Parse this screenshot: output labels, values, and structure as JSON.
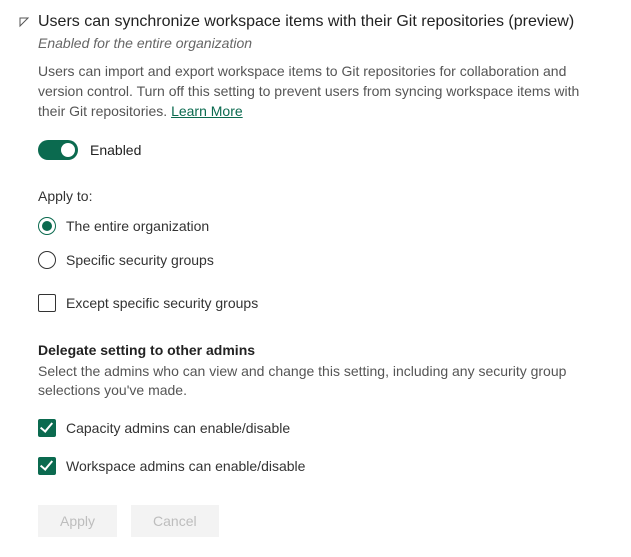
{
  "header": {
    "title": "Users can synchronize workspace items with their Git repositories (preview)",
    "subtitle": "Enabled for the entire organization"
  },
  "description": "Users can import and export workspace items to Git repositories for collaboration and version control. Turn off this setting to prevent users from syncing workspace items with their Git repositories. ",
  "learn_more": "Learn More",
  "toggle": {
    "state_label": "Enabled"
  },
  "apply_to": {
    "label": "Apply to:",
    "options": {
      "entire_org": "The entire organization",
      "specific_groups": "Specific security groups"
    },
    "except_label": "Except specific security groups"
  },
  "delegate": {
    "title": "Delegate setting to other admins",
    "description": "Select the admins who can view and change this setting, including any security group selections you've made.",
    "capacity_admins": "Capacity admins can enable/disable",
    "workspace_admins": "Workspace admins can enable/disable"
  },
  "buttons": {
    "apply": "Apply",
    "cancel": "Cancel"
  }
}
